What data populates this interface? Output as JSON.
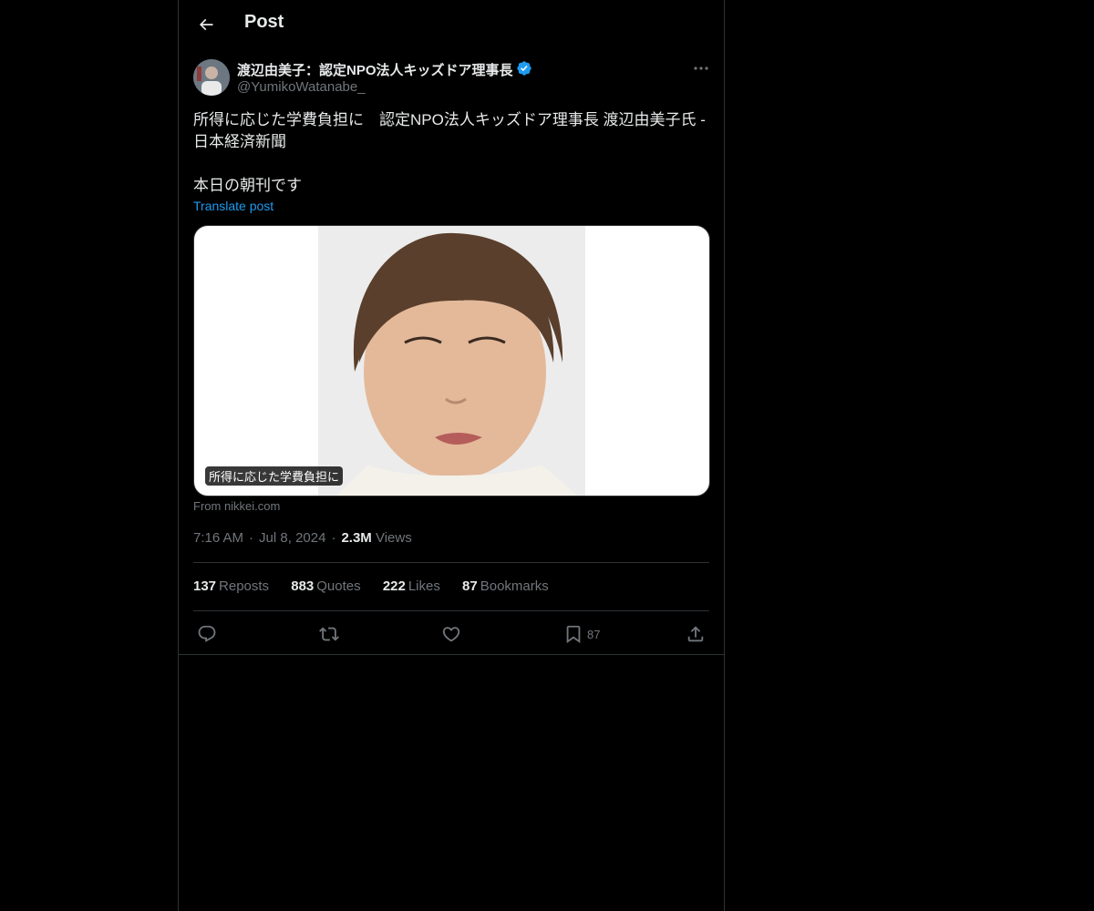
{
  "header": {
    "title": "Post",
    "back_icon": "arrow-left-icon"
  },
  "author": {
    "display_name": "渡辺由美子：認定NPO法人キッズドア理事長",
    "handle": "@YumikoWatanabe_",
    "verified": true,
    "verified_color": "#1d9bf0"
  },
  "post": {
    "text": "所得に応じた学費負担に　認定NPO法人キッズドア理事長 渡辺由美子氏 - 日本経済新聞\n\n本日の朝刊です",
    "translate_label": "Translate post"
  },
  "card": {
    "caption": "所得に応じた学費負担に",
    "source": "From nikkei.com"
  },
  "meta": {
    "time": "7:16 AM",
    "date": "Jul 8, 2024",
    "views_count": "2.3M",
    "views_label": "Views"
  },
  "stats": [
    {
      "count": "137",
      "label": "Reposts"
    },
    {
      "count": "883",
      "label": "Quotes"
    },
    {
      "count": "222",
      "label": "Likes"
    },
    {
      "count": "87",
      "label": "Bookmarks"
    }
  ],
  "actions": {
    "reply_icon": "reply-icon",
    "repost_icon": "repost-icon",
    "like_icon": "heart-icon",
    "bookmark_icon": "bookmark-icon",
    "bookmark_count": "87",
    "share_icon": "share-icon"
  },
  "colors": {
    "background": "#000000",
    "text": "#e7e9ea",
    "secondary": "#71767b",
    "accent": "#1d9bf0",
    "border": "#2f3336"
  }
}
